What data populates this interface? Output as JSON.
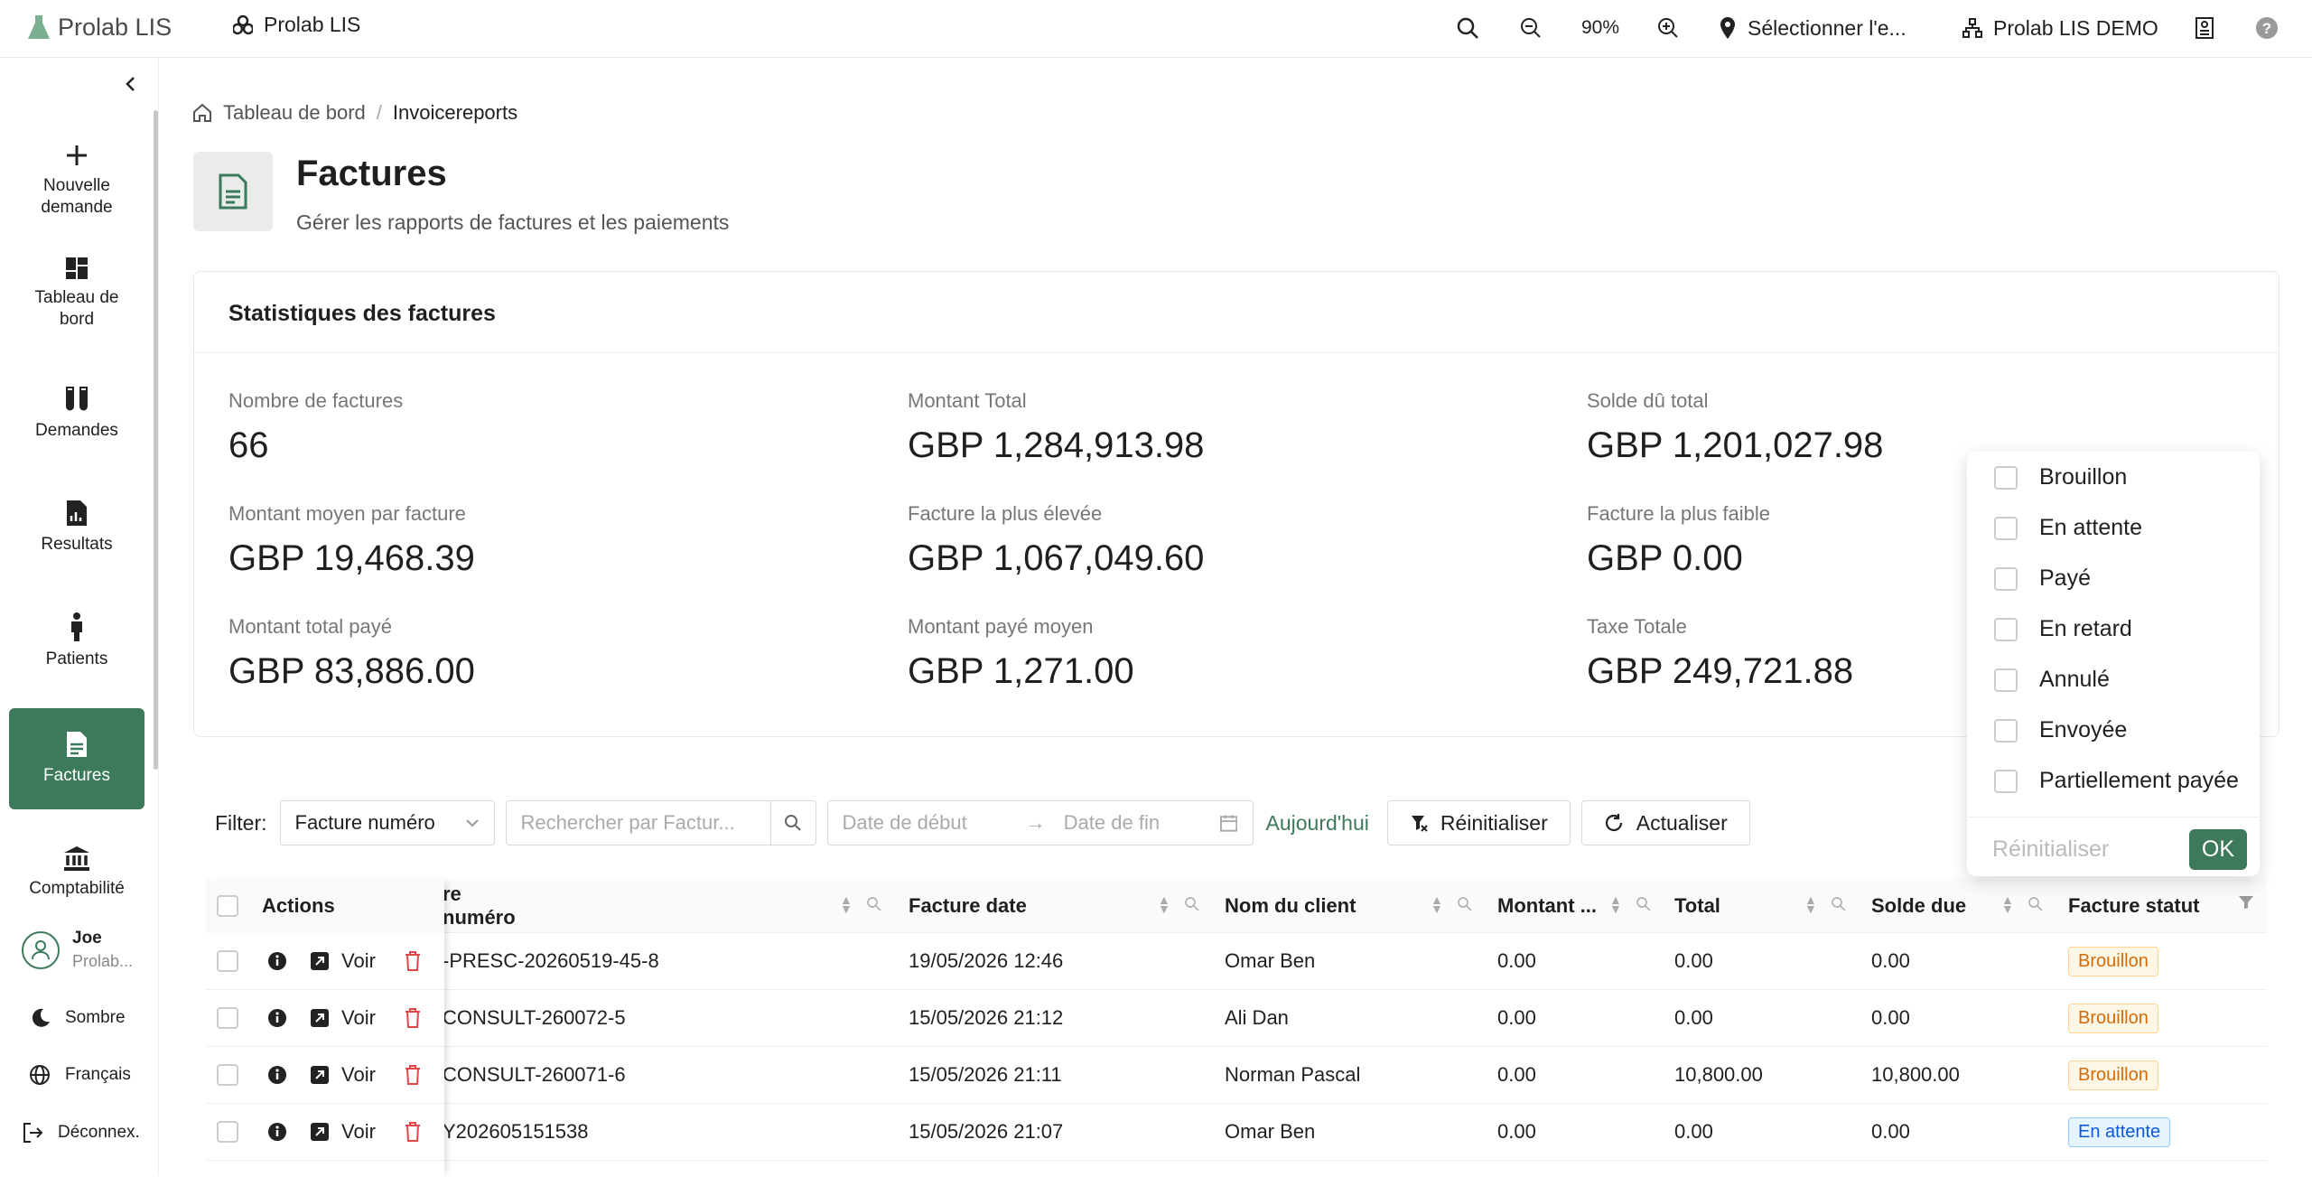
{
  "topbar": {
    "logo_text": "Prolab LIS",
    "app_name": "Prolab LIS",
    "zoom": "90%",
    "location": "Sélectionner l'e...",
    "org": "Prolab LIS DEMO"
  },
  "sidebar": {
    "items": [
      {
        "label": "Nouvelle demande"
      },
      {
        "label": "Tableau de bord"
      },
      {
        "label": "Demandes"
      },
      {
        "label": "Resultats"
      },
      {
        "label": "Patients"
      },
      {
        "label": "Factures"
      },
      {
        "label": "Comptabilité"
      }
    ],
    "user_name": "Joe",
    "user_org": "Prolab...",
    "dark_mode": "Sombre",
    "language": "Français",
    "logout": "Déconnex."
  },
  "breadcrumb": {
    "home": "Tableau de bord",
    "sep": "/",
    "current": "Invoicereports"
  },
  "page": {
    "title": "Factures",
    "subtitle": "Gérer les rapports de factures et les paiements"
  },
  "stats": {
    "title": "Statistiques des factures",
    "items": [
      {
        "label": "Nombre de factures",
        "value": "66"
      },
      {
        "label": "Montant Total",
        "value": "GBP 1,284,913.98"
      },
      {
        "label": "Solde dû total",
        "value": "GBP 1,201,027.98"
      },
      {
        "label": "Montant moyen par facture",
        "value": "GBP 19,468.39"
      },
      {
        "label": "Facture la plus élevée",
        "value": "GBP 1,067,049.60"
      },
      {
        "label": "Facture la plus faible",
        "value": "GBP 0.00"
      },
      {
        "label": "Montant total payé",
        "value": "GBP 83,886.00"
      },
      {
        "label": "Montant payé moyen",
        "value": "GBP 1,271.00"
      },
      {
        "label": "Taxe Totale",
        "value": "GBP 249,721.88"
      }
    ]
  },
  "filter": {
    "label": "Filter:",
    "field": "Facture numéro",
    "search_placeholder": "Rechercher par Factur...",
    "date_start": "Date de début",
    "date_end": "Date de fin",
    "today": "Aujourd'hui",
    "reset": "Réinitialiser",
    "refresh": "Actualiser"
  },
  "table": {
    "headers": {
      "actions": "Actions",
      "number": "re numéro",
      "date": "Facture date",
      "client": "Nom du client",
      "amount": "Montant ...",
      "total": "Total",
      "due": "Solde due",
      "status": "Facture statut"
    },
    "view_label": "Voir",
    "rows": [
      {
        "number": "-PRESC-20260519-45-8",
        "date": "19/05/2026 12:46",
        "client": "Omar Ben",
        "amount": "0.00",
        "total": "0.00",
        "due": "0.00",
        "status": "Brouillon",
        "status_kind": "draft"
      },
      {
        "number": "CONSULT-260072-5",
        "date": "15/05/2026 21:12",
        "client": "Ali Dan",
        "amount": "0.00",
        "total": "0.00",
        "due": "0.00",
        "status": "Brouillon",
        "status_kind": "draft"
      },
      {
        "number": "CONSULT-260071-6",
        "date": "15/05/2026 21:11",
        "client": "Norman Pascal",
        "amount": "0.00",
        "total": "10,800.00",
        "due": "10,800.00",
        "status": "Brouillon",
        "status_kind": "draft"
      },
      {
        "number": "Y202605151538",
        "date": "15/05/2026 21:07",
        "client": "Omar Ben",
        "amount": "0.00",
        "total": "0.00",
        "due": "0.00",
        "status": "En attente",
        "status_kind": "pending"
      }
    ]
  },
  "status_filter": {
    "options": [
      "Brouillon",
      "En attente",
      "Payé",
      "En retard",
      "Annulé",
      "Envoyée",
      "Partiellement payée"
    ],
    "reset": "Réinitialiser",
    "ok": "OK"
  },
  "colors": {
    "accent": "#3d7a5b"
  }
}
